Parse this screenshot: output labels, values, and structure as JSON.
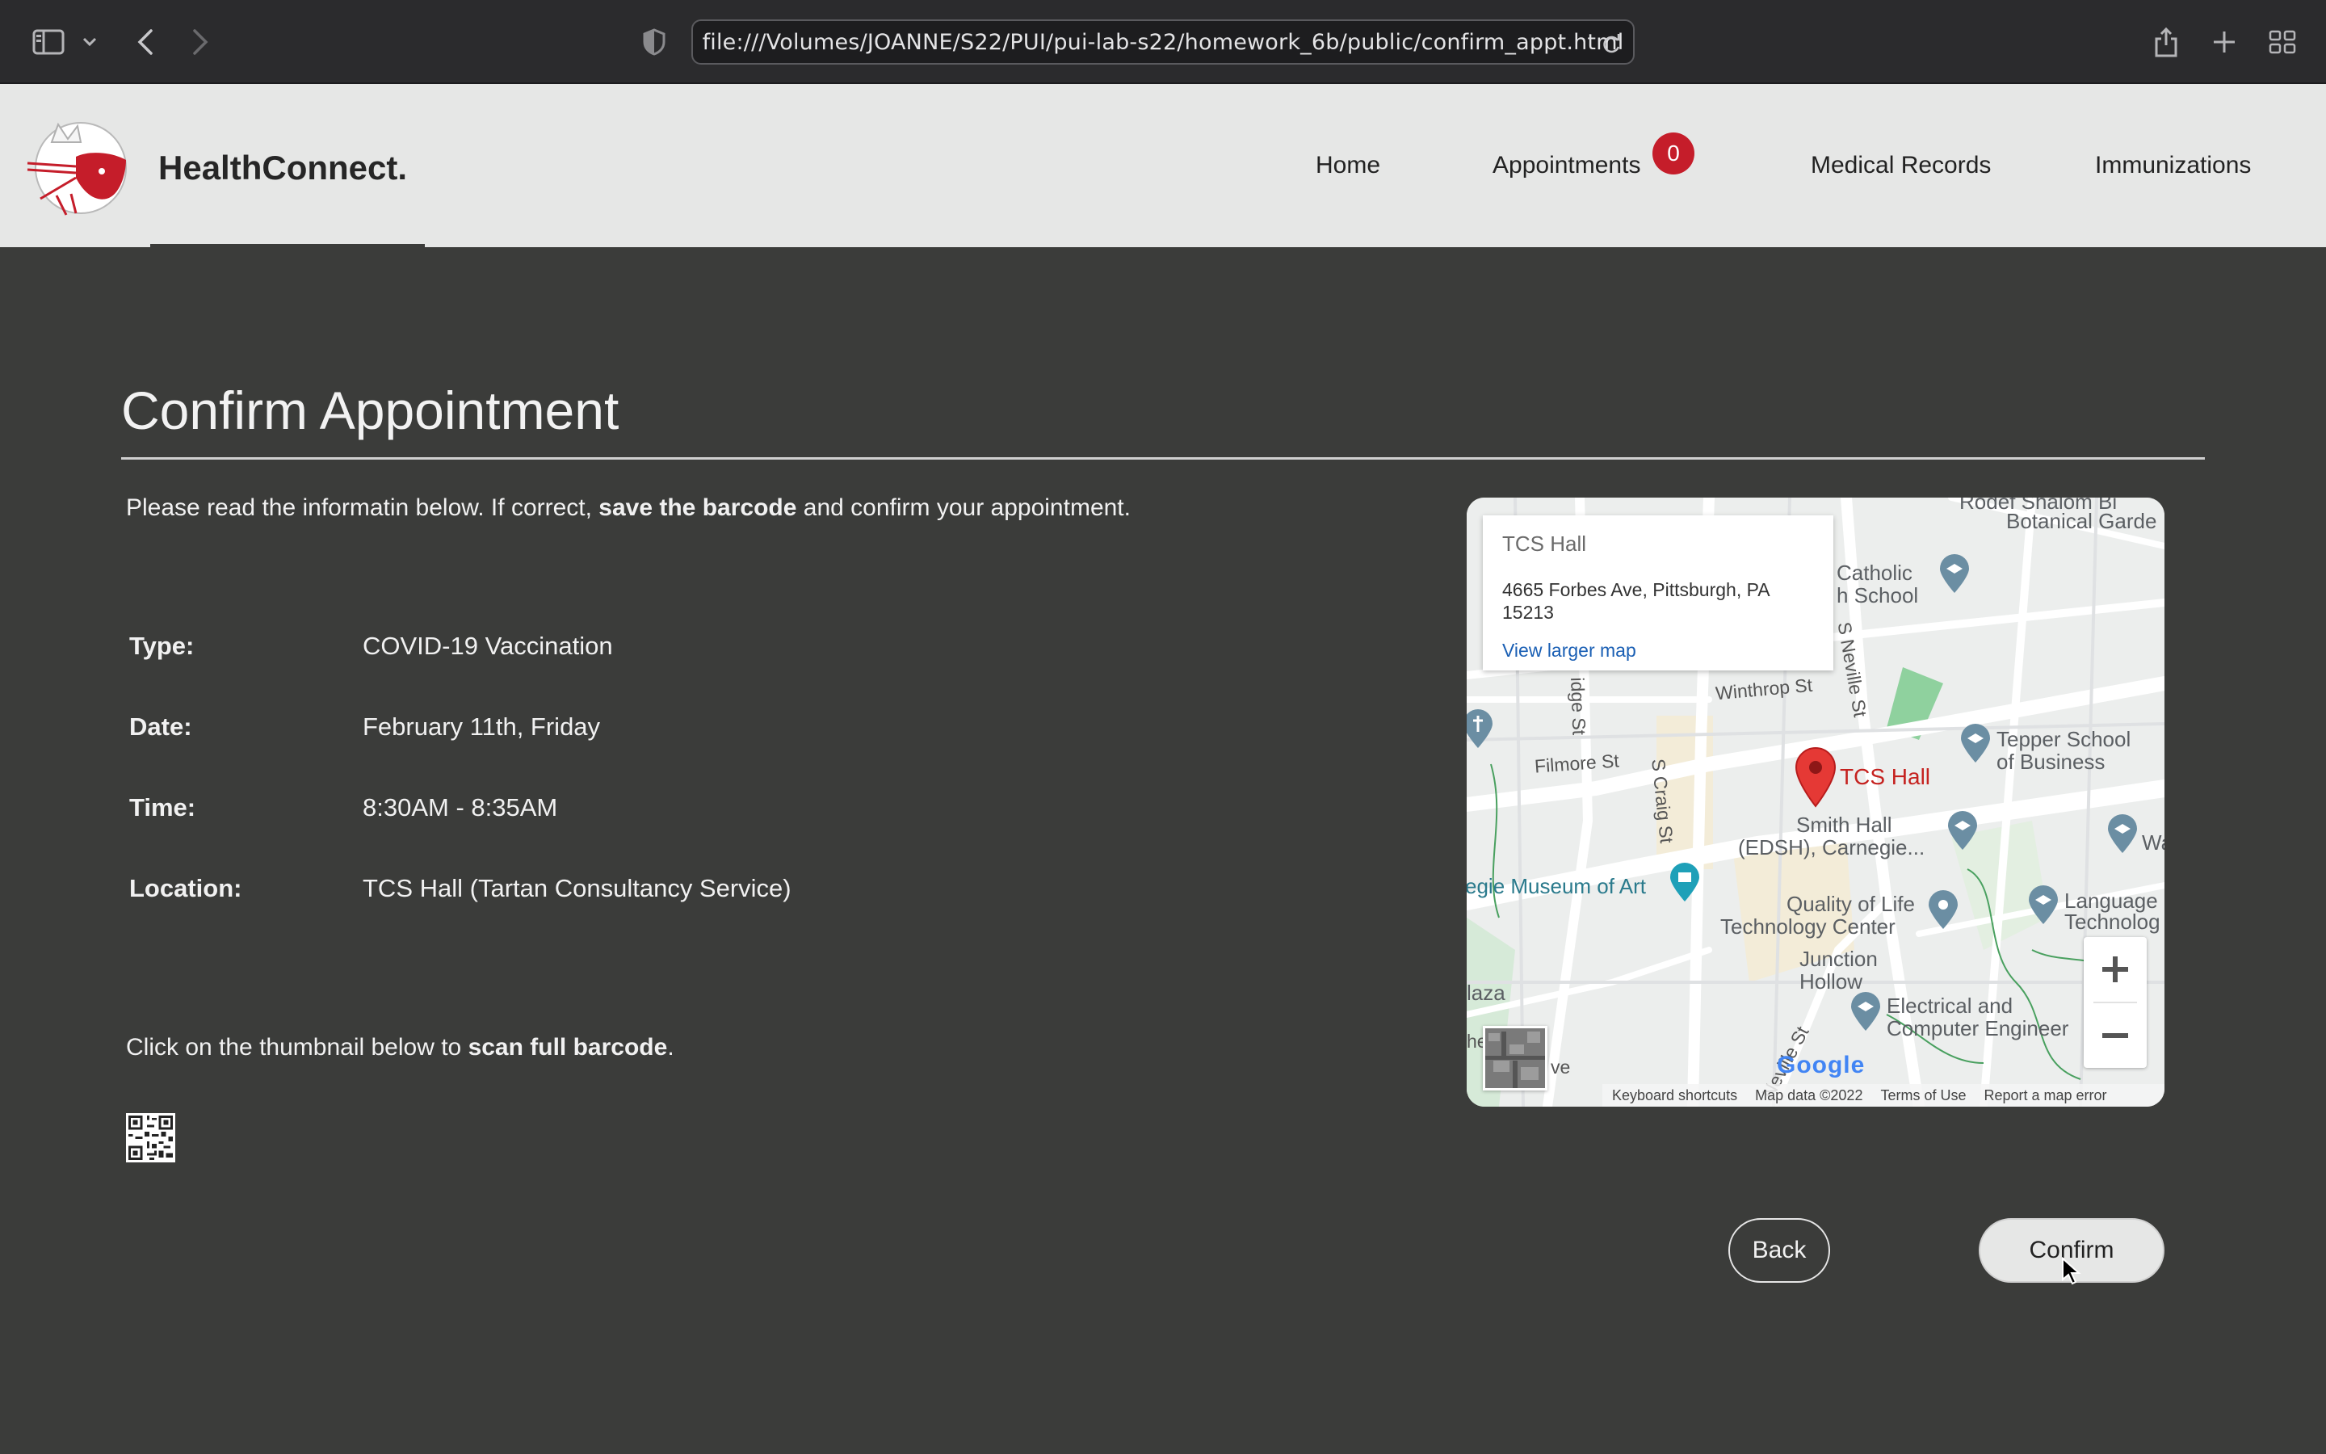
{
  "browser": {
    "url": "file:///Volumes/JOANNE/S22/PUI/pui-lab-s22/homework_6b/public/confirm_appt.html"
  },
  "site": {
    "brand": "HealthConnect.",
    "nav": {
      "home": "Home",
      "appointments": "Appointments",
      "appointments_badge": "0",
      "medical_records": "Medical Records",
      "immunizations": "Immunizations"
    }
  },
  "page": {
    "title": "Confirm Appointment",
    "intro_prefix": "Please read the informatin below. If correct, ",
    "intro_bold": "save the barcode",
    "intro_suffix": " and confirm your appointment.",
    "details": [
      {
        "label": "Type:",
        "value": "COVID-19 Vaccination"
      },
      {
        "label": "Date:",
        "value": "February 11th, Friday"
      },
      {
        "label": "Time:",
        "value": "8:30AM - 8:35AM"
      },
      {
        "label": "Location:",
        "value": "TCS Hall (Tartan Consultancy Service)"
      }
    ],
    "scan_prefix": "Click on the thumbnail below to ",
    "scan_bold": "scan full barcode",
    "scan_suffix": "."
  },
  "map": {
    "info_title": "TCS Hall",
    "info_address": "4665 Forbes Ave, Pittsburgh, PA 15213",
    "info_link": "View larger map",
    "marker_label": "TCS Hall",
    "places": {
      "botanical_1": "Rodef Shalom Bi",
      "botanical_2": "Botanical Garde",
      "catholic_1": "Catholic",
      "catholic_2": "h School",
      "tepper_1": "Tepper School",
      "tepper_2": "of Business",
      "smith_1": "Smith Hall",
      "smith_2": "(EDSH), Carnegie...",
      "museum": "egie Museum of Art",
      "qol_1": "Quality of Life",
      "qol_2": "Technology Center",
      "junction_1": "Junction",
      "junction_2": "Hollow",
      "language_1": "Language",
      "language_2": "Technolog",
      "ece_1": "Electrical and",
      "ece_2": "Computer Engineer",
      "wa": "Wa",
      "plaza": "laza"
    },
    "streets": {
      "winthrop": "Winthrop St",
      "filmore": "Filmore St",
      "craig": "S Craig St",
      "neville": "S Neville St",
      "bridge": "idge St",
      "neville_lower": "Neville St",
      "he": "he",
      "ve": "ve"
    },
    "google": "Google",
    "attribution": {
      "keyboard": "Keyboard shortcuts",
      "data": "Map data ©2022",
      "terms": "Terms of Use",
      "report": "Report a map error"
    }
  },
  "buttons": {
    "back": "Back",
    "confirm": "Confirm"
  },
  "colors": {
    "page_bg": "#3b3c3a",
    "nav_bg": "#e6e7e6",
    "badge": "#c51d2a",
    "marker": "#e53935",
    "link": "#1a5fb4"
  }
}
